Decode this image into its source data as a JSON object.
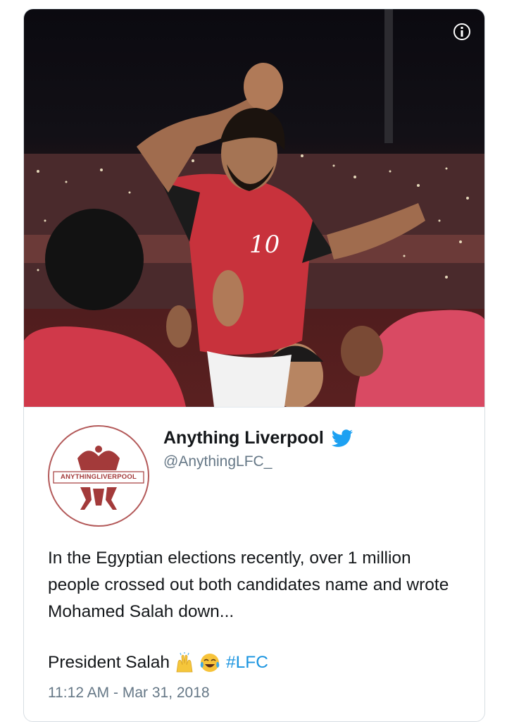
{
  "colors": {
    "link": "#1b95e0",
    "text": "#14171a",
    "secondary_text": "#657786",
    "verified_blue": "#1da1f2",
    "jersey_red": "#c8323c",
    "logo_red": "#a33a3a"
  },
  "media": {
    "info_icon": "info-icon"
  },
  "author": {
    "display_name": "Anything Liverpool",
    "handle": "@AnythingLFC_",
    "avatar_text": "ANYTHINGLIVERPOOL",
    "verified_icon": "twitter-bird-icon"
  },
  "tweet": {
    "paragraph1": "In the Egyptian elections recently, over 1 million people crossed out both candidates name and wrote Mohamed Salah down...",
    "line2_text": "President Salah",
    "emojis": [
      "raised-hands-emoji",
      "tears-of-joy-emoji"
    ],
    "hashtag": "#LFC",
    "timestamp": "11:12 AM - Mar 31, 2018"
  }
}
